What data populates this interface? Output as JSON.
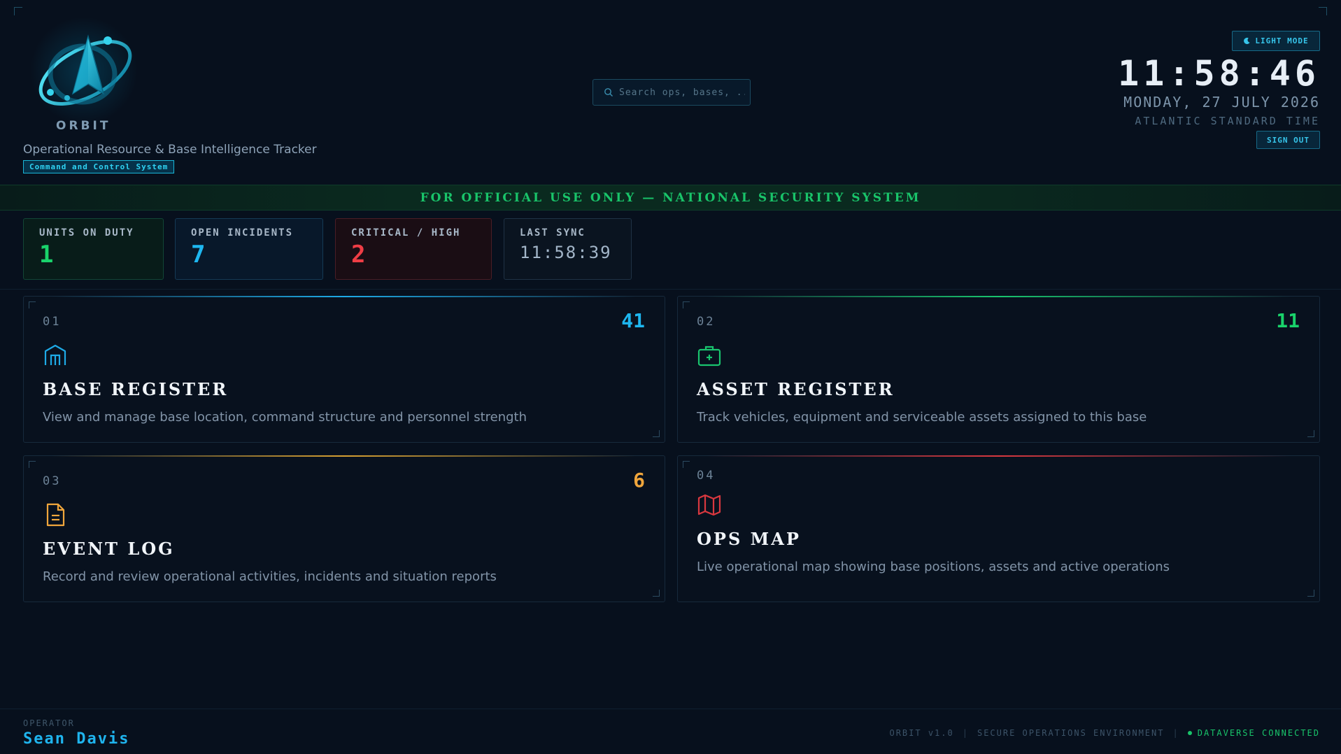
{
  "brand": {
    "name": "ORBIT",
    "subtitle": "Operational Resource & Base Intelligence Tracker",
    "badge": "Command and Control System"
  },
  "search": {
    "placeholder": "Search ops, bases, ..."
  },
  "header": {
    "light_mode_label": "LIGHT MODE",
    "time": "11:58:46",
    "date": "MONDAY, 27 JULY 2026",
    "timezone": "ATLANTIC STANDARD TIME",
    "sign_out_label": "SIGN OUT"
  },
  "banner": {
    "text": "FOR OFFICIAL USE ONLY — NATIONAL SECURITY SYSTEM"
  },
  "stats": [
    {
      "label": "UNITS ON DUTY",
      "value": "1"
    },
    {
      "label": "OPEN INCIDENTS",
      "value": "7"
    },
    {
      "label": "CRITICAL / HIGH",
      "value": "2"
    },
    {
      "label": "LAST SYNC",
      "value": "11:58:39"
    }
  ],
  "cards": [
    {
      "num": "01",
      "count": "41",
      "title": "BASE REGISTER",
      "desc": "View and manage base location, command structure and personnel strength",
      "icon": "base-building-icon",
      "color": "#1eaae6"
    },
    {
      "num": "02",
      "count": "11",
      "title": "ASSET REGISTER",
      "desc": "Track vehicles, equipment and serviceable assets assigned to this base",
      "icon": "briefcase-icon",
      "color": "#19c46e"
    },
    {
      "num": "03",
      "count": "6",
      "title": "EVENT LOG",
      "desc": "Record and review operational activities, incidents and situation reports",
      "icon": "document-icon",
      "color": "#f0a63c"
    },
    {
      "num": "04",
      "title": "OPS MAP",
      "desc": "Live operational map showing base positions, assets and active operations",
      "icon": "map-icon",
      "color": "#d8383f"
    }
  ],
  "footer": {
    "operator_label": "OPERATOR",
    "operator_name": "Sean Davis",
    "version": "ORBIT v1.0",
    "environment": "SECURE OPERATIONS ENVIRONMENT",
    "connection": "DATAVERSE CONNECTED"
  }
}
